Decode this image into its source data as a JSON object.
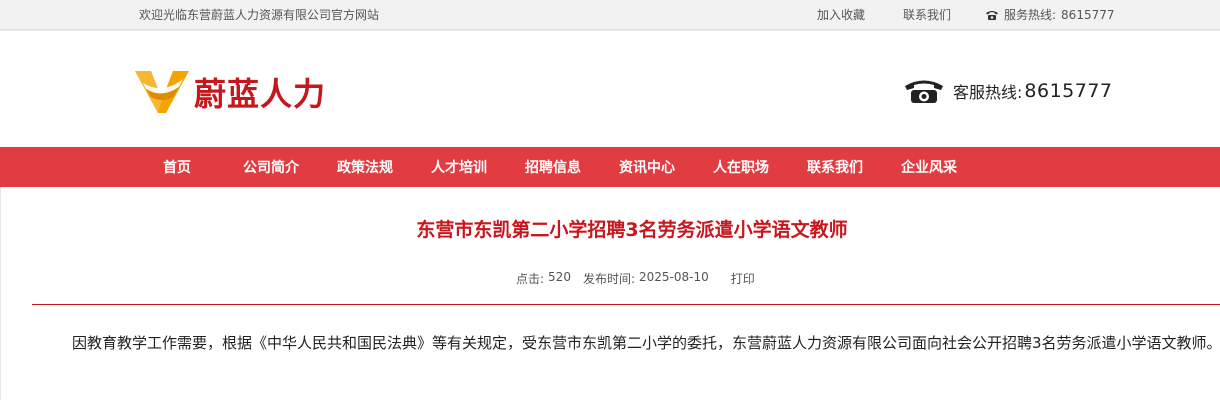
{
  "topbar": {
    "welcome": "欢迎光临东营蔚蓝人力资源有限公司官方网站",
    "add_favorite": "加入收藏",
    "contact_us": "联系我们",
    "hotline_label": "服务热线:",
    "hotline_number": "8615777"
  },
  "header": {
    "logo_text": "蔚蓝人力",
    "hotline_label": "客服热线:",
    "hotline_number": "8615777"
  },
  "nav": {
    "items": [
      "首页",
      "公司简介",
      "政策法规",
      "人才培训",
      "招聘信息",
      "资讯中心",
      "人在职场",
      "联系我们",
      "企业风采"
    ]
  },
  "article": {
    "title": "东营市东凯第二小学招聘3名劳务派遣小学语文教师",
    "views_label": "点击:",
    "views": "520",
    "date_label": "发布时间:",
    "date": "2025-08-10",
    "print": "打印",
    "paragraph": "因教育教学工作需要，根据《中华人民共和国民法典》等有关规定，受东营市东凯第二小学的委托，东营蔚蓝人力资源有限公司面向社会公开招聘3名劳务派遣小学语文教师。"
  },
  "colors": {
    "brand_red": "#c8161d",
    "nav_red": "#e03c42",
    "logo_orange": "#f5a300"
  }
}
